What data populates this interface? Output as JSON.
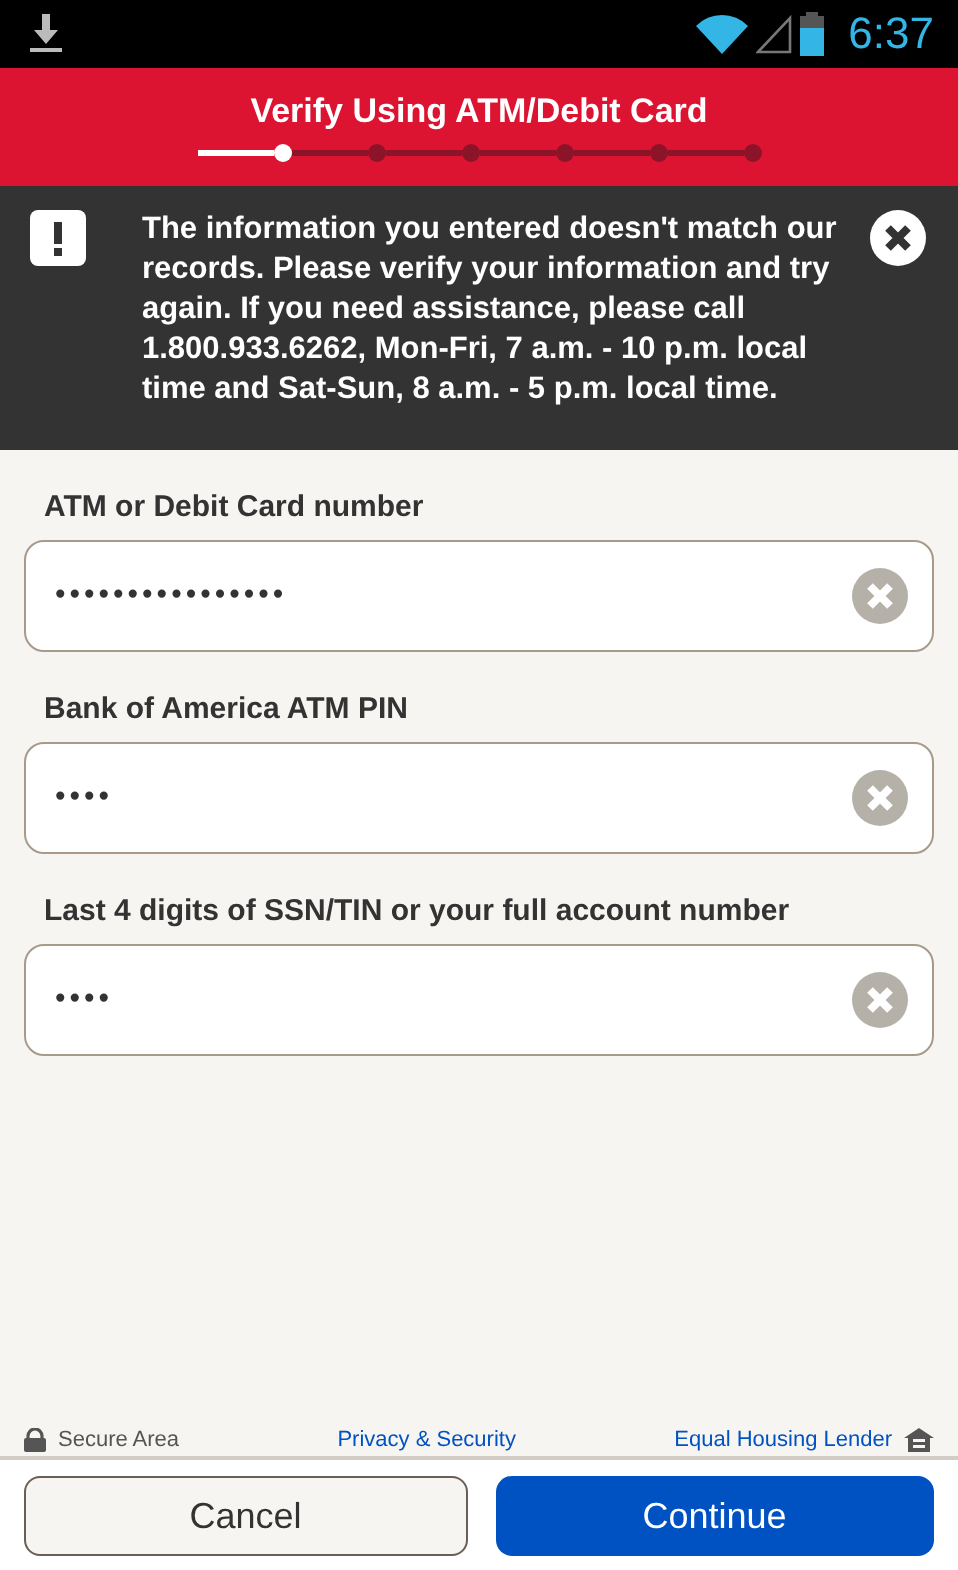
{
  "status_bar": {
    "time": "6:37"
  },
  "header": {
    "title": "Verify Using ATM/Debit Card",
    "steps": [
      {
        "selected": true
      },
      {
        "selected": false
      },
      {
        "selected": false
      },
      {
        "selected": false
      },
      {
        "selected": false
      },
      {
        "selected": false
      }
    ]
  },
  "error_banner": {
    "message": "The information you entered doesn't match our records. Please verify your information and try again. If you need assistance, please call 1.800.933.6262, Mon-Fri, 7 a.m. - 10 p.m. local time and Sat-Sun, 8 a.m. - 5 p.m. local time."
  },
  "fields": [
    {
      "label": "ATM or Debit Card number",
      "value": "••••••••••••••••"
    },
    {
      "label": "Bank of America ATM PIN",
      "value": "••••"
    },
    {
      "label": "Last 4 digits of SSN/TIN or your full account number",
      "value": "••••"
    }
  ],
  "footer": {
    "secure": "Secure Area",
    "privacy": "Privacy & Security",
    "lender": "Equal Housing Lender"
  },
  "buttons": [
    {
      "label": "Cancel",
      "kind": "secondary"
    },
    {
      "label": "Continue",
      "kind": "primary"
    }
  ]
}
